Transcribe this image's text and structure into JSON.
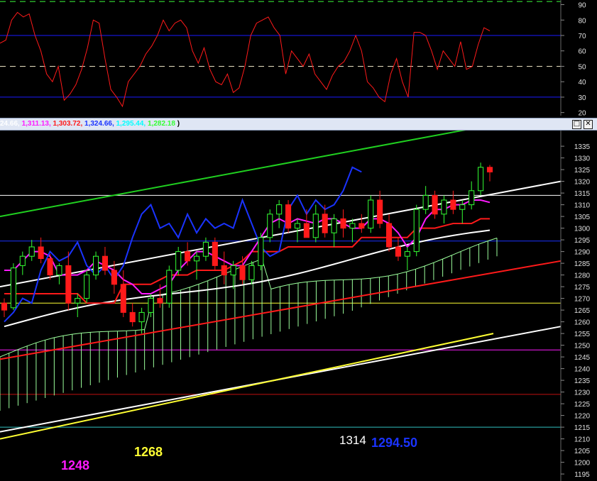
{
  "colors": {
    "background": "#000000",
    "rsi_line": "#ff1a1a",
    "rsi_band": "#1a1aff",
    "rsi_mid": "#e8e0c0",
    "rsi_top": "#3cff3c",
    "tenkan": "#ff1aff",
    "kijun": "#ff1a1a",
    "chikou": "#1a33ff",
    "senkou_a": "#9cff9c",
    "cloud": "#9cff9c",
    "bull_candle": "#33ff33",
    "bear_candle": "#ff1a1a",
    "ma": "#ffffff",
    "upper_channel": "#20d020",
    "mid_channel": "#ffffff",
    "low_trend_red": "#ff1a1a",
    "yellow_line": "#ffff33",
    "white_line_low": "#ffffff"
  },
  "legend": {
    "items": [
      {
        "text": "24.66, ",
        "color": "#ffffff"
      },
      {
        "text": "1,311.13, ",
        "color": "#ff1aff"
      },
      {
        "text": "1,303.72, ",
        "color": "#ff1a1a"
      },
      {
        "text": "1,324.66, ",
        "color": "#1a33ff"
      },
      {
        "text": "1,295.44, ",
        "color": "#00ffff"
      },
      {
        "text": "1,282.18",
        "color": "#33ff33"
      },
      {
        "text": " )",
        "color": "#000000"
      }
    ],
    "restore_glyph": "□",
    "close_glyph": "✕"
  },
  "annotations": {
    "a1248": "1248",
    "a1268": "1268",
    "a1314": "1314",
    "a1294": "1294.50"
  },
  "chart_data": [
    {
      "type": "line",
      "name_hint": "oscillator",
      "ylim": [
        18,
        93
      ],
      "y_ticks": [
        20,
        30,
        40,
        50,
        60,
        70,
        80,
        90
      ],
      "levels": {
        "upper": 70,
        "middle": 50,
        "lower": 30,
        "top": 92
      },
      "values": [
        65,
        67,
        80,
        85,
        82,
        84,
        70,
        60,
        45,
        40,
        50,
        28,
        32,
        38,
        48,
        62,
        80,
        78,
        55,
        35,
        30,
        24,
        40,
        45,
        50,
        58,
        63,
        70,
        80,
        73,
        78,
        80,
        75,
        60,
        52,
        62,
        48,
        40,
        38,
        45,
        33,
        36,
        50,
        70,
        78,
        80,
        82,
        75,
        70,
        45,
        60,
        55,
        50,
        58,
        45,
        40,
        35,
        44,
        50,
        53,
        60,
        70,
        60,
        40,
        36,
        30,
        27,
        45,
        55,
        40,
        30,
        72,
        72,
        70,
        60,
        48,
        60,
        55,
        50,
        66,
        48,
        50,
        64,
        75,
        73
      ]
    },
    {
      "type": "candlestick",
      "name_hint": "price with Ichimoku",
      "ylim": [
        1192,
        1342
      ],
      "y_ticks": [
        1195,
        1200,
        1205,
        1210,
        1215,
        1220,
        1225,
        1230,
        1235,
        1240,
        1245,
        1250,
        1255,
        1260,
        1265,
        1270,
        1275,
        1280,
        1285,
        1290,
        1295,
        1300,
        1305,
        1310,
        1315,
        1320,
        1325,
        1330,
        1335
      ],
      "ohlc": [
        [
          1268,
          1270,
          1262,
          1265
        ],
        [
          1266,
          1285,
          1265,
          1283
        ],
        [
          1284,
          1290,
          1280,
          1288
        ],
        [
          1288,
          1295,
          1286,
          1292
        ],
        [
          1292,
          1296,
          1285,
          1287
        ],
        [
          1287,
          1289,
          1278,
          1280
        ],
        [
          1280,
          1285,
          1276,
          1284
        ],
        [
          1284,
          1290,
          1265,
          1268
        ],
        [
          1268,
          1272,
          1262,
          1270
        ],
        [
          1270,
          1282,
          1268,
          1280
        ],
        [
          1280,
          1290,
          1278,
          1288
        ],
        [
          1288,
          1292,
          1280,
          1282
        ],
        [
          1282,
          1286,
          1272,
          1276
        ],
        [
          1276,
          1282,
          1262,
          1264
        ],
        [
          1264,
          1268,
          1258,
          1260
        ],
        [
          1260,
          1266,
          1255,
          1264
        ],
        [
          1264,
          1272,
          1262,
          1270
        ],
        [
          1270,
          1276,
          1266,
          1268
        ],
        [
          1268,
          1284,
          1266,
          1282
        ],
        [
          1282,
          1292,
          1280,
          1290
        ],
        [
          1290,
          1294,
          1284,
          1286
        ],
        [
          1286,
          1290,
          1278,
          1288
        ],
        [
          1288,
          1296,
          1286,
          1294
        ],
        [
          1294,
          1296,
          1282,
          1284
        ],
        [
          1284,
          1290,
          1276,
          1280
        ],
        [
          1280,
          1286,
          1274,
          1284
        ],
        [
          1284,
          1288,
          1276,
          1278
        ],
        [
          1278,
          1286,
          1276,
          1284
        ],
        [
          1284,
          1298,
          1282,
          1296
        ],
        [
          1296,
          1308,
          1294,
          1306
        ],
        [
          1306,
          1312,
          1300,
          1310
        ],
        [
          1310,
          1312,
          1298,
          1300
        ],
        [
          1300,
          1304,
          1294,
          1302
        ],
        [
          1302,
          1308,
          1298,
          1296
        ],
        [
          1296,
          1310,
          1294,
          1306
        ],
        [
          1306,
          1310,
          1296,
          1298
        ],
        [
          1298,
          1306,
          1292,
          1304
        ],
        [
          1304,
          1308,
          1296,
          1300
        ],
        [
          1300,
          1304,
          1294,
          1302
        ],
        [
          1302,
          1306,
          1298,
          1300
        ],
        [
          1300,
          1314,
          1298,
          1312
        ],
        [
          1312,
          1316,
          1300,
          1302
        ],
        [
          1302,
          1306,
          1290,
          1292
        ],
        [
          1292,
          1296,
          1286,
          1288
        ],
        [
          1288,
          1292,
          1282,
          1290
        ],
        [
          1290,
          1310,
          1288,
          1308
        ],
        [
          1308,
          1318,
          1306,
          1314
        ],
        [
          1314,
          1316,
          1304,
          1306
        ],
        [
          1306,
          1314,
          1302,
          1312
        ],
        [
          1312,
          1316,
          1306,
          1308
        ],
        [
          1308,
          1312,
          1302,
          1310
        ],
        [
          1310,
          1320,
          1308,
          1316
        ],
        [
          1316,
          1328,
          1314,
          1326
        ],
        [
          1326,
          1327,
          1320,
          1324
        ]
      ],
      "ichimoku": {
        "tenkan": [
          1282,
          1282,
          1286,
          1290,
          1290,
          1288,
          1280,
          1280,
          1280,
          1282,
          1286,
          1284,
          1282,
          1278,
          1276,
          1272,
          1272,
          1274,
          1276,
          1282,
          1286,
          1290,
          1290,
          1288,
          1286,
          1284,
          1284,
          1290,
          1296,
          1302,
          1304,
          1302,
          1304,
          1303,
          1302,
          1304,
          1304,
          1302,
          1300,
          1300,
          1304,
          1304,
          1302,
          1298,
          1292,
          1296,
          1304,
          1308,
          1308,
          1310,
          1310,
          1312,
          1312,
          1311
        ],
        "kijun": [
          1272,
          1272,
          1272,
          1272,
          1272,
          1272,
          1272,
          1272,
          1272,
          1268,
          1268,
          1268,
          1268,
          1276,
          1276,
          1276,
          1276,
          1278,
          1280,
          1280,
          1280,
          1282,
          1282,
          1282,
          1282,
          1284,
          1286,
          1290,
          1290,
          1290,
          1290,
          1292,
          1292,
          1292,
          1292,
          1292,
          1292,
          1292,
          1292,
          1296,
          1296,
          1296,
          1296,
          1296,
          1296,
          1300,
          1300,
          1300,
          1301,
          1302,
          1302,
          1302,
          1304,
          1304
        ]
      }
    }
  ]
}
